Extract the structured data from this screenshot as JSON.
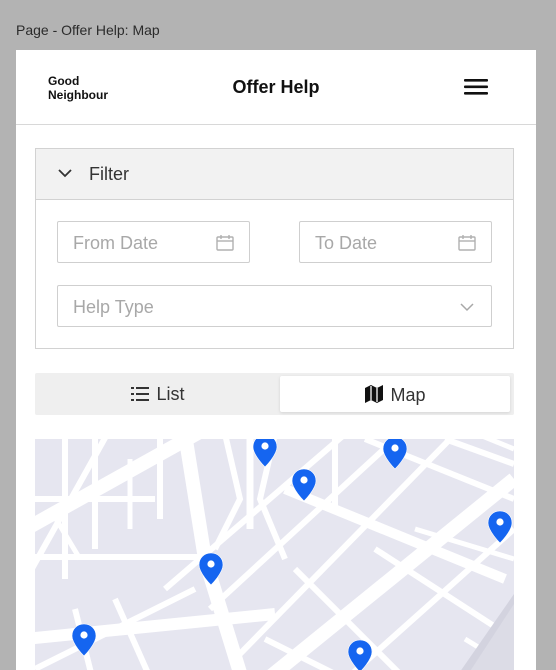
{
  "frame": {
    "label": "Page - Offer Help: Map"
  },
  "header": {
    "logo_line1": "Good",
    "logo_line2": "Neighbour",
    "title": "Offer Help",
    "menu_icon": "hamburger-menu-icon"
  },
  "filter": {
    "label": "Filter",
    "from_date": {
      "placeholder": "From Date",
      "icon": "calendar-icon"
    },
    "to_date": {
      "placeholder": "To Date",
      "icon": "calendar-icon"
    },
    "help_type": {
      "placeholder": "Help Type",
      "icon": "chevron-down-icon"
    }
  },
  "view_tabs": {
    "list_label": "List",
    "map_label": "Map",
    "selected": "Map"
  },
  "map": {
    "background_color": "#e6e6f0",
    "road_color": "#ffffff",
    "pin_color": "#1565f0",
    "pin_count": 8
  }
}
